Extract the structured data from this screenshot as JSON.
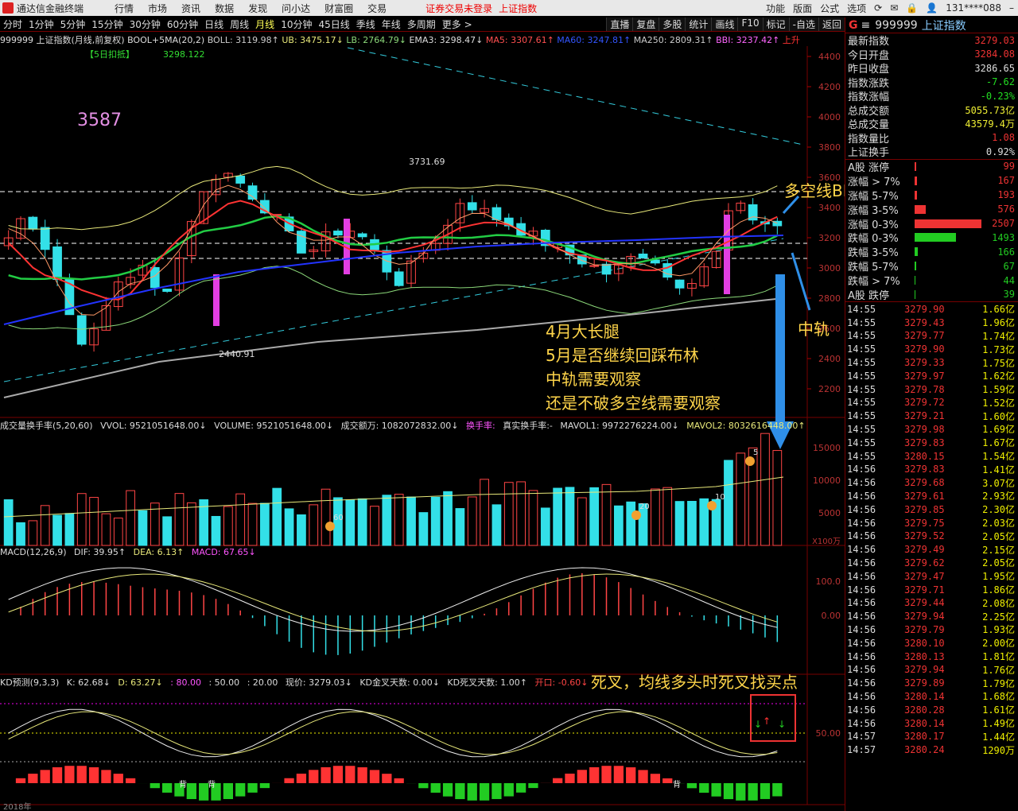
{
  "app": {
    "title": "通达信金融终端",
    "menus": [
      "行情",
      "市场",
      "资讯",
      "数据",
      "发现",
      "问小达",
      "财富圈",
      "交易"
    ],
    "warning": "证券交易未登录",
    "index_link": "上证指数",
    "right_menus": [
      "功能",
      "版面",
      "公式",
      "选项"
    ],
    "account": "131****088"
  },
  "periods": [
    "分时",
    "1分钟",
    "5分钟",
    "15分钟",
    "30分钟",
    "60分钟",
    "日线",
    "周线",
    "月线",
    "10分钟",
    "45日线",
    "季线",
    "年线",
    "多周期",
    "更多 >"
  ],
  "selected_period": "月线",
  "tools": [
    "直播",
    "复盘",
    "多股",
    "统计",
    "画线",
    "F10",
    "标记",
    "-自选",
    "返回"
  ],
  "main_info": [
    {
      "t": "999999 上证指数(月线,前复权)",
      "c": "#dddddd"
    },
    {
      "t": "BOOL+5MA(20,2)",
      "c": "#dddddd"
    },
    {
      "t": "BOLL: 3119.98↑",
      "c": "#cccccc"
    },
    {
      "t": "UB: 3475.17↓",
      "c": "#e8e87a"
    },
    {
      "t": "LB: 2764.79↓",
      "c": "#8cd97a"
    },
    {
      "t": "EMA3: 3298.47↓",
      "c": "#dddddd"
    },
    {
      "t": "MA5: 3307.61↑",
      "c": "#ff5050"
    },
    {
      "t": "MA60: 3247.81↑",
      "c": "#3355ff"
    },
    {
      "t": "MA250: 2809.31↑",
      "c": "#cccccc"
    },
    {
      "t": "BBI: 3237.42↑",
      "c": "#ff66ff"
    },
    {
      "t": "上升",
      "c": "#ff3333"
    }
  ],
  "deduct": {
    "label": "【5日扣抵】",
    "value": "3298.122"
  },
  "price_axis": [
    "4400",
    "4200",
    "4000",
    "3800",
    "3600",
    "3400",
    "3200",
    "3000",
    "2800",
    "2600",
    "2400",
    "2200"
  ],
  "labels": {
    "high": "3731.69",
    "low": "2440.91",
    "big": "3587"
  },
  "vol_info": [
    {
      "t": "成交量换手率(5,20,60)",
      "c": "#dddddd"
    },
    {
      "t": "VVOL: 9521051648.00↓",
      "c": "#dddddd"
    },
    {
      "t": "VOLUME: 9521051648.00↓",
      "c": "#dddddd"
    },
    {
      "t": "成交额万: 1082072832.00↓",
      "c": "#dddddd"
    },
    {
      "t": "换手率:",
      "c": "#ff55ff"
    },
    {
      "t": "真实换手率:-",
      "c": "#dddddd"
    },
    {
      "t": "MAVOL1: 9972276224.00↓",
      "c": "#dddddd"
    },
    {
      "t": "MAVOL2: 8032616448.00↑",
      "c": "#e8e87a"
    }
  ],
  "vol_axis": [
    "15000",
    "10000",
    "5000"
  ],
  "vol_unit": "X100万",
  "vol_marks": [
    "60",
    "20",
    "10",
    "5"
  ],
  "macd_info": [
    {
      "t": "MACD(12,26,9)",
      "c": "#dddddd"
    },
    {
      "t": "DIF: 39.95↑",
      "c": "#dddddd"
    },
    {
      "t": "DEA: 6.13↑",
      "c": "#e8e87a"
    },
    {
      "t": "MACD: 67.65↓",
      "c": "#ff55ff"
    }
  ],
  "macd_axis": [
    "100.0",
    "0.00"
  ],
  "kd_info": [
    {
      "t": "KD预测(9,3,3)",
      "c": "#dddddd"
    },
    {
      "t": "K: 62.68↓",
      "c": "#dddddd"
    },
    {
      "t": "D: 63.27↓",
      "c": "#e8e87a"
    },
    {
      "t": ": 80.00",
      "c": "#ff55ff"
    },
    {
      "t": ": 50.00",
      "c": "#dddddd"
    },
    {
      "t": ": 20.00",
      "c": "#dddddd"
    },
    {
      "t": "现价: 3279.03↓",
      "c": "#dddddd"
    },
    {
      "t": "KD金叉天数: 0.00↓",
      "c": "#dddddd"
    },
    {
      "t": "KD死叉天数: 1.00↑",
      "c": "#dddddd"
    },
    {
      "t": "开口: -0.60↓",
      "c": "#ff4444"
    }
  ],
  "kd_axis": [
    "50.00"
  ],
  "kd_marks": [
    "背",
    "背",
    "背"
  ],
  "bottom_date": "2018年",
  "annotations": {
    "bbi": "多空线BBI",
    "mid": "中轨",
    "note": [
      "4月大长腿",
      "5月是否继续回踩布林",
      "中轨需要观察",
      "还是不破多空线需要观察"
    ],
    "kd": "死叉，均线多头时死叉找买点"
  },
  "panel": {
    "g": "G",
    "code": "999999",
    "name": "上证指数",
    "quote": [
      {
        "l": "最新指数",
        "v": "3279.03",
        "c": "#ee3333"
      },
      {
        "l": "今日开盘",
        "v": "3284.08",
        "c": "#ee3333"
      },
      {
        "l": "昨日收盘",
        "v": "3286.65",
        "c": "#dddddd"
      },
      {
        "l": "指数涨跌",
        "v": "-7.62",
        "c": "#22dd22"
      },
      {
        "l": "指数涨幅",
        "v": "-0.23%",
        "c": "#22dd22"
      },
      {
        "l": "总成交额",
        "v": "5055.73亿",
        "c": "#eeee33"
      },
      {
        "l": "总成交量",
        "v": "43579.4万",
        "c": "#eeee33"
      },
      {
        "l": "指数量比",
        "v": "1.08",
        "c": "#ee3333"
      },
      {
        "l": "上证换手",
        "v": "0.92%",
        "c": "#dddddd"
      }
    ],
    "breadth": [
      {
        "l": "A股 涨停",
        "v": "99",
        "c": "#ee3333",
        "f": 0.02
      },
      {
        "l": "涨幅 > 7%",
        "v": "167",
        "c": "#ee3333",
        "f": 0.03
      },
      {
        "l": "涨幅 5-7%",
        "v": "193",
        "c": "#ee3333",
        "f": 0.04
      },
      {
        "l": "涨幅 3-5%",
        "v": "576",
        "c": "#ee3333",
        "f": 0.17
      },
      {
        "l": "涨幅 0-3%",
        "v": "2507",
        "c": "#ee3333",
        "f": 1.0
      },
      {
        "l": "跌幅 0-3%",
        "v": "1493",
        "c": "#22cc22",
        "f": 0.62
      },
      {
        "l": "跌幅 3-5%",
        "v": "166",
        "c": "#22cc22",
        "f": 0.05
      },
      {
        "l": "跌幅 5-7%",
        "v": "67",
        "c": "#22cc22",
        "f": 0.02
      },
      {
        "l": "跌幅 > 7%",
        "v": "44",
        "c": "#22cc22",
        "f": 0.01
      },
      {
        "l": "A股 跌停",
        "v": "39",
        "c": "#22cc22",
        "f": 0.01
      }
    ],
    "ticks": [
      [
        "14:55",
        "3279.90",
        "1.66亿"
      ],
      [
        "14:55",
        "3279.43",
        "1.96亿"
      ],
      [
        "14:55",
        "3279.77",
        "1.74亿"
      ],
      [
        "14:55",
        "3279.90",
        "1.73亿"
      ],
      [
        "14:55",
        "3279.33",
        "1.75亿"
      ],
      [
        "14:55",
        "3279.97",
        "1.62亿"
      ],
      [
        "14:55",
        "3279.78",
        "1.59亿"
      ],
      [
        "14:55",
        "3279.72",
        "1.52亿"
      ],
      [
        "14:55",
        "3279.21",
        "1.60亿"
      ],
      [
        "14:55",
        "3279.98",
        "1.69亿"
      ],
      [
        "14:55",
        "3279.83",
        "1.67亿"
      ],
      [
        "14:55",
        "3280.15",
        "1.54亿"
      ],
      [
        "14:56",
        "3279.83",
        "1.41亿"
      ],
      [
        "14:56",
        "3279.68",
        "3.07亿"
      ],
      [
        "14:56",
        "3279.61",
        "2.93亿"
      ],
      [
        "14:56",
        "3279.85",
        "2.30亿"
      ],
      [
        "14:56",
        "3279.75",
        "2.03亿"
      ],
      [
        "14:56",
        "3279.52",
        "2.05亿"
      ],
      [
        "14:56",
        "3279.49",
        "2.15亿"
      ],
      [
        "14:56",
        "3279.62",
        "2.05亿"
      ],
      [
        "14:56",
        "3279.47",
        "1.95亿"
      ],
      [
        "14:56",
        "3279.71",
        "1.86亿"
      ],
      [
        "14:56",
        "3279.44",
        "2.08亿"
      ],
      [
        "14:56",
        "3279.94",
        "2.25亿"
      ],
      [
        "14:56",
        "3279.79",
        "1.93亿"
      ],
      [
        "14:56",
        "3280.10",
        "2.00亿"
      ],
      [
        "14:56",
        "3280.13",
        "1.81亿"
      ],
      [
        "14:56",
        "3279.94",
        "1.76亿"
      ],
      [
        "14:56",
        "3279.89",
        "1.79亿"
      ],
      [
        "14:56",
        "3280.14",
        "1.68亿"
      ],
      [
        "14:56",
        "3280.28",
        "1.61亿"
      ],
      [
        "14:56",
        "3280.14",
        "1.49亿"
      ],
      [
        "14:57",
        "3280.17",
        "1.44亿"
      ],
      [
        "14:57",
        "3280.24",
        "1290万"
      ]
    ]
  }
}
